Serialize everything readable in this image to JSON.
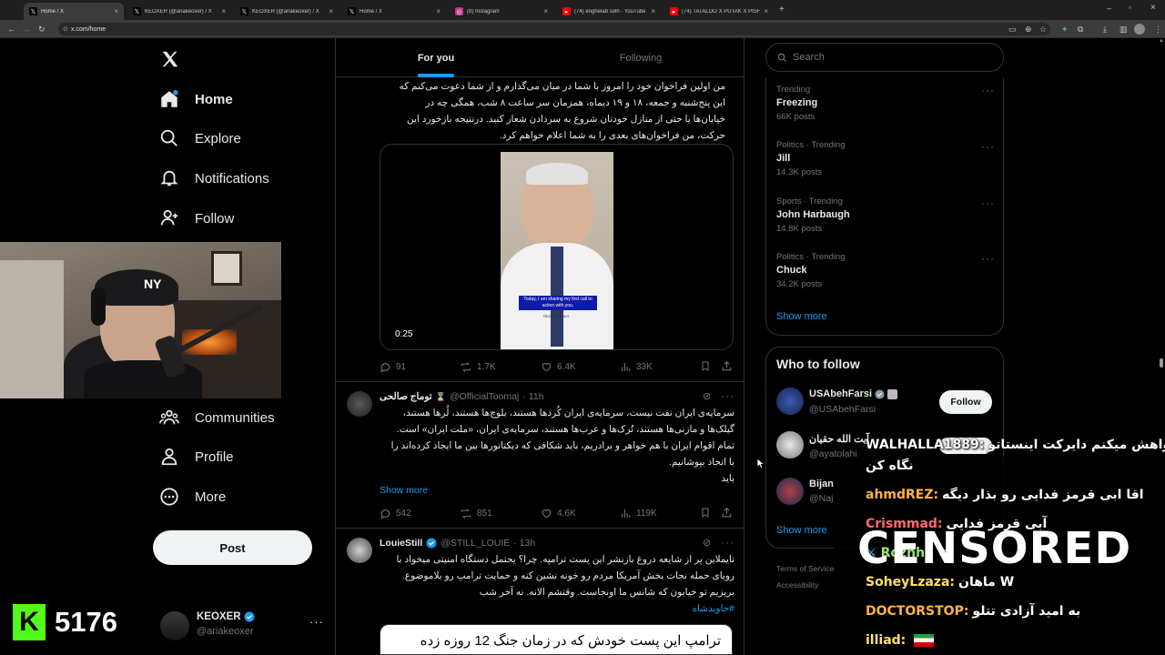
{
  "browser": {
    "tabs": [
      {
        "title": "Home / X",
        "icon": "x-logo-icon",
        "active": true
      },
      {
        "title": "KEOXER (@ariakeoxer) / X",
        "icon": "x-logo-icon"
      },
      {
        "title": "KEOXER (@ariakeoxer) / X",
        "icon": "x-logo-icon"
      },
      {
        "title": "Home / X",
        "icon": "x-logo-icon"
      },
      {
        "title": "(8) Instagram",
        "icon": "instagram-icon"
      },
      {
        "title": "(74) enghelab solh - YouTube",
        "icon": "youtube-icon"
      },
      {
        "title": "(74) TATALOO X PUTAK X PISHRO",
        "icon": "youtube-icon"
      }
    ],
    "url": "x.com/home"
  },
  "sidebar": {
    "nav": [
      {
        "label": "Home",
        "icon": "home-icon"
      },
      {
        "label": "Explore",
        "icon": "search-icon"
      },
      {
        "label": "Notifications",
        "icon": "bell-icon"
      },
      {
        "label": "Follow",
        "icon": "follow-icon"
      },
      {
        "label": "Communities",
        "icon": "communities-icon"
      },
      {
        "label": "Profile",
        "icon": "person-icon"
      },
      {
        "label": "More",
        "icon": "more-circle-icon"
      }
    ],
    "post_label": "Post",
    "account": {
      "name": "KEOXER",
      "handle": "@ariakeoxer"
    }
  },
  "stream": {
    "viewer_count": "5176",
    "brand": "K"
  },
  "feed": {
    "tabs": [
      "For you",
      "Following"
    ],
    "tweets": [
      {
        "text": [
          "من اولین فراخوان خود را امروز با شما در میان می‌گذارم و از شما دعوت می‌کنم که",
          "این پنج‌شنبه و جمعه، ۱۸ و ۱۹ دیماه، همزمان سر ساعت ۸ شب، همگی چه در",
          "خیابان‌ها یا حتی از منازل خودتان شروع به سردادن شعار کنید. درنتیجه بازخورد این",
          "حرکت، من فراخوان‌های بعدی را به شما اعلام خواهم کرد."
        ],
        "video": {
          "duration": "0:25",
          "caption": "Today, I am sharing my first call to action with you.",
          "logo": "REZA PAHLAVI"
        },
        "stats": {
          "replies": "91",
          "reposts": "1.7K",
          "likes": "6.4K",
          "views": "33K"
        }
      },
      {
        "name": "توماج صالحی",
        "handle": "@OfficialToomaj",
        "time": "· 11h",
        "text": [
          "سرمایه‌ی ایران نفت نیست، سرمایه‌ی ایران کُردها هستند، بلوچ‌ها هستند، لُرها هستند،",
          "گیلک‌ها و مازنی‌ها هستند، تُرک‌ها و عرب‌ها هستند، سرمایه‌ی ایران، «ملت ایران» است.",
          "تمام اقوام ایران با هم خواهر و برادریم، باید شکافی که دیکتاتورها بین ما ایجاد کرده‌اند را",
          "با اتحاد بپوشانیم.",
          "باید"
        ],
        "show_more": "Show more",
        "stats": {
          "replies": "542",
          "reposts": "851",
          "likes": "4.6K",
          "views": "119K"
        }
      },
      {
        "name": "LouieStill",
        "handle": "@STILL_LOUIE",
        "time": "· 13h",
        "text": [
          "تایملاین پر از شایعه دروغ بازنشر این پست ترامپه. چرا؟ یحتمل دستگاه امنیتی میخواد با",
          "رویای حمله نجات بخش آمریکا مردم رو خونه نشین کنه و حمایت ترامپ رو بلاموضوع.",
          "بریزیم تو خیابون که شانس ما اونجاست. وقتشم الانه. نه آخر شب"
        ],
        "hashtag": "#جاویدشاه",
        "quote_text": "ترامپ این پست خودش که در زمان جنگ 12 روزه زده"
      }
    ]
  },
  "right": {
    "search_placeholder": "Search",
    "trends": [
      {
        "category": "Trending",
        "name": "Freezing",
        "count": "66K posts"
      },
      {
        "category": "Politics · Trending",
        "name": "Jill",
        "count": "14.3K posts"
      },
      {
        "category": "Sports · Trending",
        "name": "John Harbaugh",
        "count": "14.8K posts"
      },
      {
        "category": "Politics · Trending",
        "name": "Chuck",
        "count": "34.2K posts"
      }
    ],
    "trends_show_more": "Show more",
    "who_to_follow": {
      "title": "Who to follow",
      "accounts": [
        {
          "name": "USAbehFarsi",
          "handle": "@USAbehFarsi"
        },
        {
          "name": "آیت الله حقیان",
          "handle": "@ayatolahi"
        },
        {
          "name": "Bijan",
          "handle": "@Naj"
        }
      ],
      "follow_label": "Follow",
      "show_more": "Show more"
    },
    "footer": [
      "Terms of Service",
      "Accessibility"
    ]
  },
  "chat": [
    {
      "user": "WALHALLA1889:",
      "msg": "خواهش میکنم دایرکت اینستاتو",
      "color": "#ffffff"
    },
    {
      "user": "",
      "msg": "نگاه کن",
      "color": "#ffffff"
    },
    {
      "user": "ahmdREZ:",
      "msg": "اقا ابی قرمز فدایی رو بذار دیگه",
      "color": "#ffb347"
    },
    {
      "user": "Crismmad:",
      "msg": "آبی قرمز فدایی",
      "color": "#ff6b6b"
    },
    {
      "user": "Rozhhi:",
      "msg": "",
      "color": "#9be37a"
    },
    {
      "user": "SoheyLzaza:",
      "msg": "ماهان W",
      "color": "#ffe066"
    },
    {
      "user": "DOCTORSTOP:",
      "msg": "به امید آزادی تتلو",
      "color": "#ffb347"
    },
    {
      "user": "illiad:",
      "msg": "",
      "color": "#ffe066"
    }
  ],
  "censor_text": "CENSORED"
}
